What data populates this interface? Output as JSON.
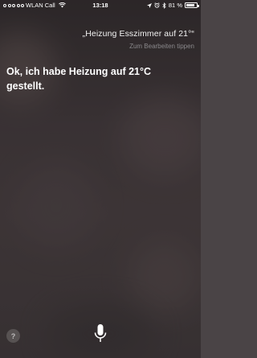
{
  "status_bar": {
    "carrier": "WLAN Call",
    "time": "13:18",
    "battery_percent": "81 %",
    "battery_level": 0.81,
    "signal_bars_filled": 0
  },
  "siri": {
    "query": "„Heizung Esszimmer auf 21°“",
    "edit_hint": "Zum Bearbeiten tippen",
    "response": "Ok, ich habe Heizung auf 21°C gestellt.",
    "help_label": "?"
  },
  "icons": [
    "wifi-icon",
    "location-icon",
    "alarm-icon",
    "bluetooth-icon",
    "battery-icon",
    "microphone-icon"
  ]
}
